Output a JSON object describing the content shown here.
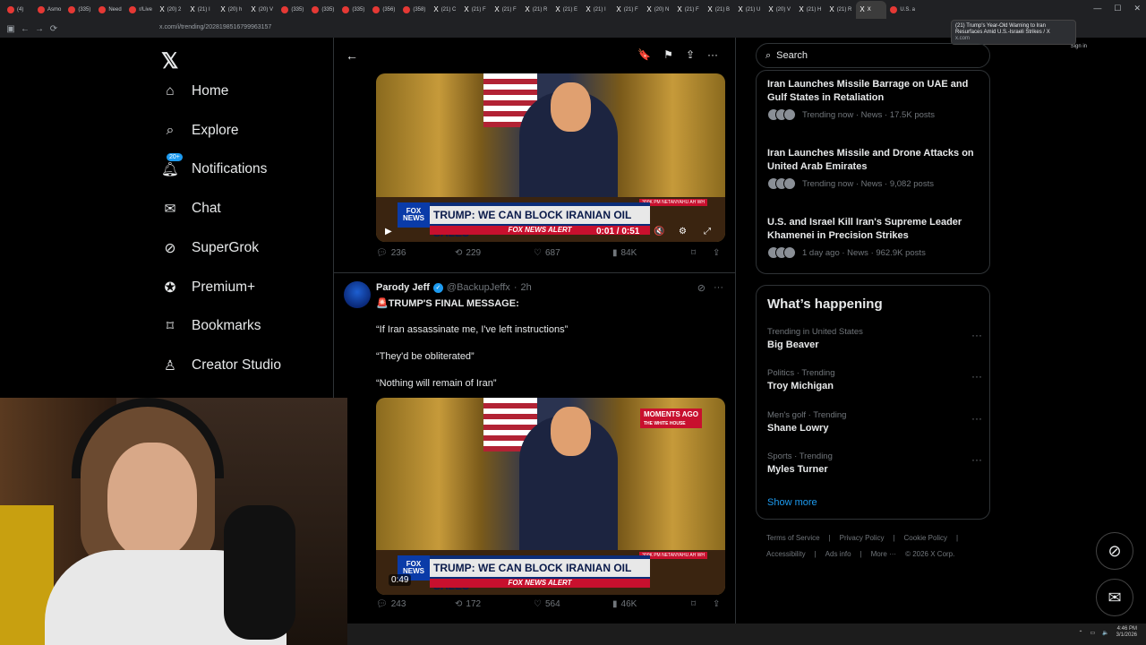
{
  "browser": {
    "tabs": [
      "(4)",
      "Asmo",
      "(335)",
      "Need",
      "r/Live",
      "(20) 2",
      "(21) I",
      "(20) h",
      "(20) V",
      "(335)",
      "(335)",
      "(335)",
      "(356)",
      "(358)",
      "(21) C",
      "(21) F",
      "(21) F",
      "(21) R",
      "(21) E",
      "(21) I",
      "(21) F",
      "(20) N",
      "(21) F",
      "(21) B",
      "(21) U",
      "(20) V",
      "(21) H",
      "(21) R",
      "X",
      "U.S. a"
    ],
    "url": "x.com/i/trending/2028198516799963157",
    "tooltip_title": "(21) Trump's Year-Old Warning to Iran Resurfaces Amid U.S.-Israeli Strikes / X",
    "tooltip_domain": "x.com",
    "signin": "Sign in"
  },
  "nav": {
    "items": [
      {
        "label": "Home",
        "icon": "home-icon"
      },
      {
        "label": "Explore",
        "icon": "search-icon"
      },
      {
        "label": "Notifications",
        "icon": "bell-icon",
        "badge": "20+"
      },
      {
        "label": "Chat",
        "icon": "mail-icon"
      },
      {
        "label": "SuperGrok",
        "icon": "grok-icon"
      },
      {
        "label": "Premium+",
        "icon": "verified-icon"
      },
      {
        "label": "Bookmarks",
        "icon": "bookmark-icon"
      },
      {
        "label": "Creator Studio",
        "icon": "creator-icon"
      }
    ]
  },
  "post1": {
    "video": {
      "headline": "TRUMP: WE CAN BLOCK IRANIAN OIL SALES",
      "alert": "FOX NEWS ALERT",
      "time": "0:01 / 0:51",
      "tag": "300K PM NETANYAHU AH WH"
    },
    "stats": {
      "replies": "236",
      "reposts": "229",
      "likes": "687",
      "views": "84K"
    }
  },
  "post2": {
    "name": "Parody Jeff",
    "handle": "@BackupJeffx",
    "time": "2h",
    "lines": [
      "🚨TRUMP'S FINAL MESSAGE:",
      "“If Iran assassinate me, I've left instructions”",
      "“They'd be obliterated”",
      "“Nothing will remain of Iran”"
    ],
    "video": {
      "headline": "TRUMP: WE CAN BLOCK IRANIAN OIL SALES",
      "alert": "FOX NEWS ALERT",
      "time": "0:49",
      "moments": "MOMENTS AGO",
      "moments_sub": "THE WHITE HOUSE",
      "tag": "300K PM NETANYAHU AH WH"
    },
    "stats": {
      "replies": "243",
      "reposts": "172",
      "likes": "564",
      "views": "46K"
    }
  },
  "right": {
    "search_placeholder": "Search",
    "trends": [
      {
        "title": "Iran Launches Missile Barrage on UAE and Gulf States in Retaliation",
        "meta": "Trending now · News · 17.5K posts"
      },
      {
        "title": "Iran Launches Missile and Drone Attacks on United Arab Emirates",
        "meta": "Trending now · News · 9,082 posts"
      },
      {
        "title": "U.S. and Israel Kill Iran's Supreme Leader Khamenei in Precision Strikes",
        "meta": "1 day ago · News · 962.9K posts"
      }
    ],
    "whats_happening": "What’s happening",
    "happening": [
      {
        "context": "Trending in United States",
        "name": "Big Beaver"
      },
      {
        "context": "Politics · Trending",
        "name": "Troy Michigan"
      },
      {
        "context": "Men's golf · Trending",
        "name": "Shane Lowry"
      },
      {
        "context": "Sports · Trending",
        "name": "Myles Turner"
      }
    ],
    "show_more": "Show more",
    "footer": [
      "Terms of Service",
      "|",
      "Privacy Policy",
      "|",
      "Cookie Policy",
      "|",
      "Accessibility",
      "|",
      "Ads info",
      "|",
      "More ···",
      "© 2026 X Corp."
    ]
  },
  "taskbar": {
    "time": "4:46 PM",
    "date": "3/1/2026"
  }
}
